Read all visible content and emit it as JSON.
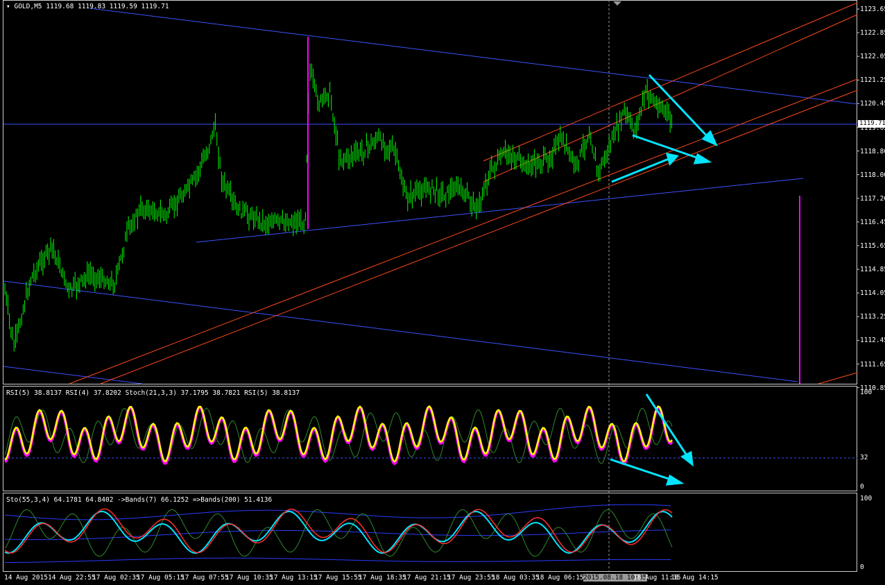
{
  "main": {
    "title": "GOLD,M5",
    "ohlc": "1119.68 1119.83 1119.59 1119.71",
    "current_price": "1119.71",
    "price_labels": [
      "1123.65",
      "1122.85",
      "1122.05",
      "1121.25",
      "1120.45",
      "1119.65",
      "1118.80",
      "1118.00",
      "1117.20",
      "1116.45",
      "1115.65",
      "1114.85",
      "1114.05",
      "1113.25",
      "1112.45",
      "1111.65",
      "1110.85"
    ]
  },
  "rsi_panel": {
    "title": "RSI(5) 38.8137  RSI(4) 37.8202  Stoch(21,3,3) 37.1795 38.7821  RSI(5) 38.8137",
    "labels": [
      "100",
      "32",
      "0"
    ]
  },
  "sto_panel": {
    "title": "Sto(55,3,4) 64.1781 64.8402  ->Bands(7) 66.1252  =>Bands(200) 51.4136",
    "labels": [
      "100",
      "0"
    ]
  },
  "time_axis": {
    "labels": [
      "14 Aug 2015",
      "14 Aug 22:55",
      "17 Aug 02:35",
      "17 Aug 05:15",
      "17 Aug 07:55",
      "17 Aug 10:35",
      "17 Aug 13:15",
      "17 Aug 15:55",
      "17 Aug 18:35",
      "17 Aug 21:15",
      "17 Aug 23:55",
      "18 Aug 03:35",
      "18 Aug 06:15",
      "2015.08.18 10:35",
      "18 Aug 11:35",
      "18 Aug 14:15"
    ],
    "cursor_label": "2015.08.18 10:35"
  },
  "colors": {
    "background": "#000000",
    "candles": "#00ff00",
    "trendline": "#3a52ff",
    "channel": "#ff4a1a",
    "arrow": "#00e5ff",
    "spike": "#ff00ff",
    "rsi": "#ffff00",
    "stoch": "#ff00ff"
  }
}
